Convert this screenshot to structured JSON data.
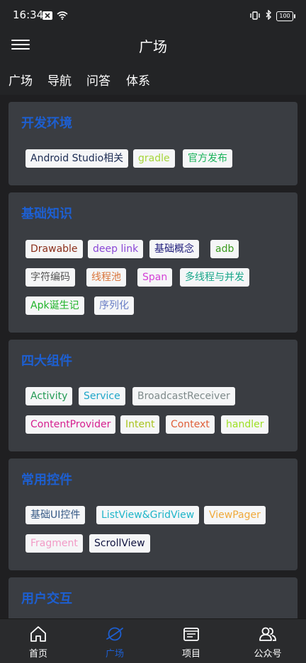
{
  "status": {
    "time": "16:34",
    "battery": "100"
  },
  "appbar": {
    "title": "广场"
  },
  "tabs": [
    "广场",
    "导航",
    "问答",
    "体系"
  ],
  "cards": [
    {
      "title": "开发环境",
      "tags": [
        {
          "label": "Android Studio相关",
          "color": "#1b2b52"
        },
        {
          "label": "gradle",
          "color": "#a6d63a"
        },
        {
          "label": "官方发布",
          "color": "#19b35a"
        }
      ]
    },
    {
      "title": "基础知识",
      "tags": [
        {
          "label": "Drawable",
          "color": "#8b2e1a"
        },
        {
          "label": "deep link",
          "color": "#8a47d6"
        },
        {
          "label": "基础概念",
          "color": "#1d1b7a"
        },
        {
          "label": "adb",
          "color": "#3a9b1e"
        },
        {
          "label": "字符编码",
          "color": "#555555"
        },
        {
          "label": "线程池",
          "color": "#d9743a"
        },
        {
          "label": "Span",
          "color": "#d340d6"
        },
        {
          "label": "多线程与并发",
          "color": "#19a68a"
        },
        {
          "label": "Apk诞生记",
          "color": "#20b42a"
        },
        {
          "label": "序列化",
          "color": "#6a7fc6"
        }
      ]
    },
    {
      "title": "四大组件",
      "tags": [
        {
          "label": "Activity",
          "color": "#239a54"
        },
        {
          "label": "Service",
          "color": "#1ea6c9"
        },
        {
          "label": "BroadcastReceiver",
          "color": "#7f8b8b"
        },
        {
          "label": "ContentProvider",
          "color": "#d61f8f"
        },
        {
          "label": "Intent",
          "color": "#a9c41f"
        },
        {
          "label": "Context",
          "color": "#e0603a"
        },
        {
          "label": "handler",
          "color": "#9ee025"
        }
      ]
    },
    {
      "title": "常用控件",
      "tags": [
        {
          "label": "基础UI控件",
          "color": "#375a86"
        },
        {
          "label": "ListView&GridView",
          "color": "#1eb5c9"
        },
        {
          "label": "ViewPager",
          "color": "#f0a93a"
        },
        {
          "label": "Fragment",
          "color": "#f29ac6"
        },
        {
          "label": "ScrollView",
          "color": "#101440"
        }
      ]
    },
    {
      "title": "用户交互",
      "tags": []
    }
  ],
  "bottomnav": [
    {
      "label": "首页",
      "icon": "home-icon",
      "active": false
    },
    {
      "label": "广场",
      "icon": "planet-icon",
      "active": true
    },
    {
      "label": "项目",
      "icon": "project-icon",
      "active": false
    },
    {
      "label": "公众号",
      "icon": "people-icon",
      "active": false
    }
  ],
  "colors": {
    "accent": "#1d5fd1",
    "card": "#3a3d42",
    "bar": "#232426"
  }
}
